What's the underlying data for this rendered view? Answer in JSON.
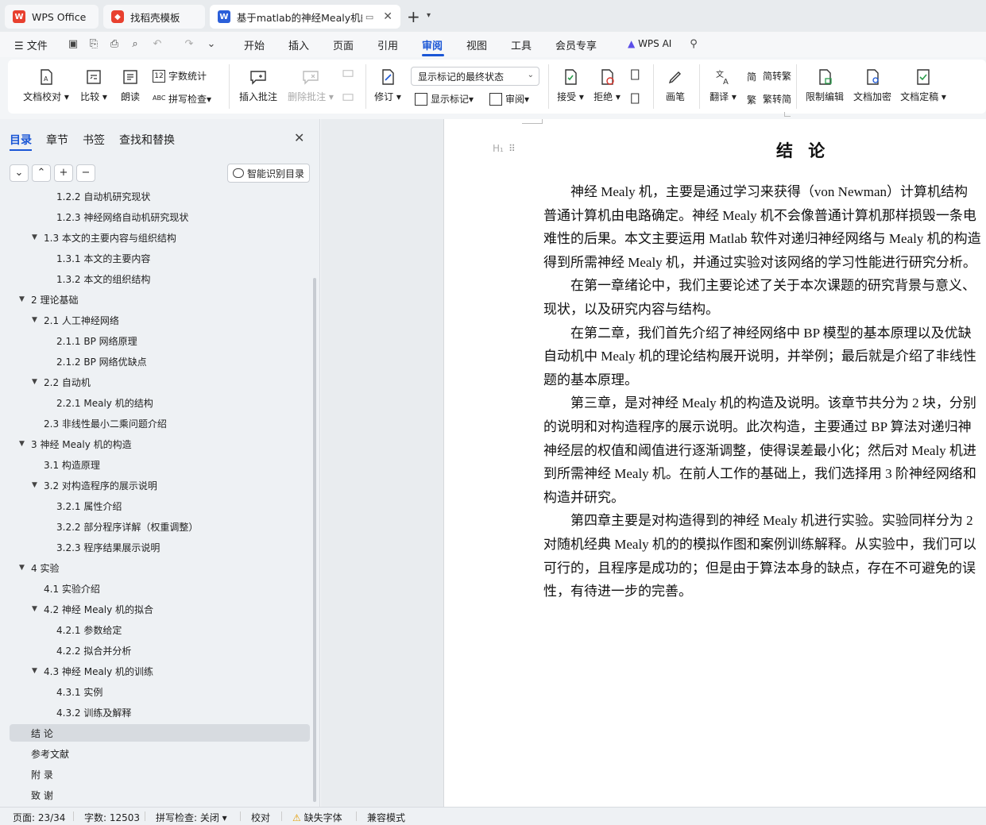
{
  "tabs": [
    {
      "label": "WPS Office"
    },
    {
      "label": "找稻壳模板"
    },
    {
      "label": "基于matlab的神经Mealy机的"
    }
  ],
  "menu": {
    "file": "文件",
    "items": [
      "开始",
      "插入",
      "页面",
      "引用",
      "审阅",
      "视图",
      "工具",
      "会员专享"
    ],
    "active": "审阅",
    "wps_ai": "WPS AI"
  },
  "ribbon": {
    "proofread": "文档校对",
    "compare": "比较",
    "read_aloud": "朗读",
    "word_count": "字数统计",
    "spell_check": "拼写检查",
    "insert_comment": "插入批注",
    "delete_comment": "删除批注",
    "revise": "修订",
    "markup_state": "显示标记的最终状态",
    "show_markup": "显示标记",
    "review": "审阅",
    "accept": "接受",
    "reject": "拒绝",
    "pen": "画笔",
    "translate": "翻译",
    "to_traditional": "简转繁",
    "to_simplified": "繁转简",
    "restrict_edit": "限制编辑",
    "encrypt": "文档加密",
    "finalize": "文档定稿"
  },
  "nav": {
    "tabs": [
      "目录",
      "章节",
      "书签",
      "查找和替换"
    ],
    "smart_toc": "智能识别目录",
    "toc": [
      {
        "label": "1.2.2  自动机研究现状",
        "level": 3
      },
      {
        "label": "1.2.3  神经网络自动机研究现状",
        "level": 3
      },
      {
        "label": "1.3  本文的主要内容与组织结构",
        "level": 2,
        "expanded": true
      },
      {
        "label": "1.3.1  本文的主要内容",
        "level": 3
      },
      {
        "label": "1.3.2  本文的组织结构",
        "level": 3
      },
      {
        "label": "2  理论基础",
        "level": 1,
        "expanded": true
      },
      {
        "label": "2.1  人工神经网络",
        "level": 2,
        "expanded": true
      },
      {
        "label": "2.1.1 BP 网络原理",
        "level": 3
      },
      {
        "label": "2.1.2 BP 网络优缺点",
        "level": 3
      },
      {
        "label": "2.2  自动机",
        "level": 2,
        "expanded": true
      },
      {
        "label": "2.2.1 Mealy 机的结构",
        "level": 3
      },
      {
        "label": "2.3  非线性最小二乘问题介绍",
        "level": 2
      },
      {
        "label": "3  神经 Mealy 机的构造",
        "level": 1,
        "expanded": true
      },
      {
        "label": "3.1  构造原理",
        "level": 2
      },
      {
        "label": "3.2  对构造程序的展示说明",
        "level": 2,
        "expanded": true
      },
      {
        "label": "3.2.1  属性介绍",
        "level": 3
      },
      {
        "label": "3.2.2  部分程序详解（权重调整）",
        "level": 3
      },
      {
        "label": "3.2.3  程序结果展示说明",
        "level": 3
      },
      {
        "label": "4  实验",
        "level": 1,
        "expanded": true
      },
      {
        "label": "4.1  实验介绍",
        "level": 2
      },
      {
        "label": "4.2  神经 Mealy 机的拟合",
        "level": 2,
        "expanded": true
      },
      {
        "label": "4.2.1  参数给定",
        "level": 3
      },
      {
        "label": "4.2.2  拟合并分析",
        "level": 3
      },
      {
        "label": "4.3  神经 Mealy 机的训练",
        "level": 2,
        "expanded": true
      },
      {
        "label": "4.3.1  实例",
        "level": 3
      },
      {
        "label": "4.3.2  训练及解释",
        "level": 3
      },
      {
        "label": "结  论",
        "level": 1,
        "selected": true
      },
      {
        "label": "参考文献",
        "level": 1
      },
      {
        "label": "附  录",
        "level": 1
      },
      {
        "label": "致  谢",
        "level": 1
      }
    ]
  },
  "document": {
    "heading": "结 论",
    "lines": [
      "　　神经 Mealy 机，主要是通过学习来获得（von Newman）计算机结构",
      "普通计算机由电路确定。神经 Mealy 机不会像普通计算机那样损毁一条电",
      "难性的后果。本文主要运用 Matlab 软件对递归神经网络与 Mealy 机的构造",
      "得到所需神经 Mealy 机，并通过实验对该网络的学习性能进行研究分析。",
      "　　在第一章绪论中，我们主要论述了关于本次课题的研究背景与意义、",
      "现状，以及研究内容与结构。",
      "　　在第二章，我们首先介绍了神经网络中 BP 模型的基本原理以及优缺",
      "自动机中 Mealy 机的理论结构展开说明，并举例；最后就是介绍了非线性",
      "题的基本原理。",
      "　　第三章，是对神经 Mealy 机的构造及说明。该章节共分为 2 块，分别",
      "的说明和对构造程序的展示说明。此次构造，主要通过 BP 算法对递归神",
      "神经层的权值和阈值进行逐渐调整，使得误差最小化；然后对 Mealy 机进",
      "到所需神经 Mealy 机。在前人工作的基础上，我们选择用 3 阶神经网络和",
      "构造并研究。",
      "　　第四章主要是对构造得到的神经 Mealy 机进行实验。实验同样分为 2",
      "对随机经典 Mealy 机的的模拟作图和案例训练解释。从实验中，我们可以",
      "可行的，且程序是成功的；但是由于算法本身的缺点，存在不可避免的误",
      "性，有待进一步的完善。"
    ]
  },
  "status": {
    "page": "页面: 23/34",
    "words": "字数: 12503",
    "spell": "拼写检查: 关闭",
    "proof": "校对",
    "missing_font": "缺失字体",
    "compat": "兼容模式"
  },
  "colors": {
    "accent": "#1a56d6",
    "wps_red": "#e8402f"
  }
}
